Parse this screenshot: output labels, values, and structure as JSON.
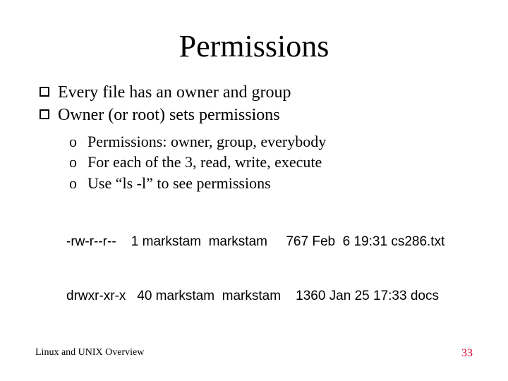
{
  "title": "Permissions",
  "bullets": [
    "Every file has an owner and group",
    "Owner (or root) sets permissions"
  ],
  "subbullets": [
    "Permissions: owner, group, everybody",
    "For each of the 3, read, write, execute",
    "Use “ls -l” to see permissions"
  ],
  "listing": [
    "-rw-r--r--    1 markstam  markstam     767 Feb  6 19:31 cs286.txt",
    "drwxr-xr-x   40 markstam  markstam    1360 Jan 25 17:33 docs"
  ],
  "footer_left": "Linux and UNIX Overview",
  "page_number": "33",
  "sub_marker": "o"
}
